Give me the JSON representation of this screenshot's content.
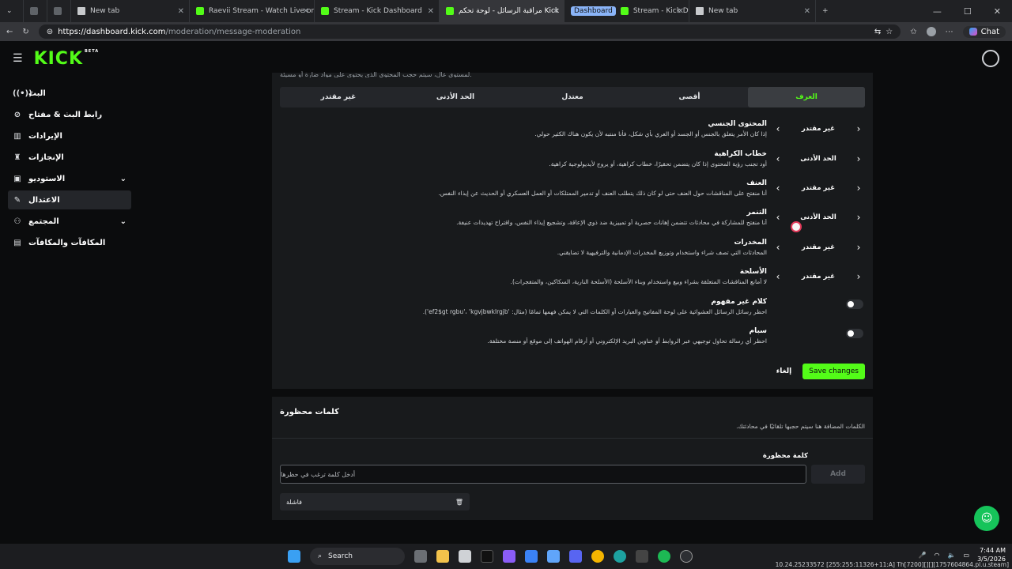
{
  "browser": {
    "tabs": [
      {
        "label": "",
        "favicon": "grey",
        "active": false
      },
      {
        "label": "",
        "favicon": "grey",
        "active": false
      },
      {
        "label": "New tab",
        "favicon": "doc",
        "active": false
      },
      {
        "label": "Raevii Stream - Watch Live on Kick",
        "favicon": "kick",
        "active": false
      },
      {
        "label": "Stream - Kick Dashboard",
        "favicon": "kick",
        "active": false
      },
      {
        "label": "مراقبة الرسائل - لوحة تحكم Kick",
        "favicon": "kick",
        "active": true
      },
      {
        "label": "Stream - Kick Dashboard",
        "favicon": "kick",
        "active": false,
        "group": "Dashboard"
      },
      {
        "label": "New tab",
        "favicon": "doc",
        "active": false
      }
    ],
    "url_host": "https://dashboard.kick.com",
    "url_path": "/moderation/message-moderation",
    "chat_label": "Chat"
  },
  "app": {
    "logo": "KICK",
    "logo_beta": "BETA",
    "sidebar": [
      {
        "label": "البث",
        "icon": "broadcast-icon",
        "active": false,
        "chevron": false
      },
      {
        "label": "رابط البث & مفتاح",
        "icon": "link-icon",
        "active": false,
        "chevron": false
      },
      {
        "label": "الإيرادات",
        "icon": "chart-icon",
        "active": false,
        "chevron": false
      },
      {
        "label": "الإنجازات",
        "icon": "trophy-icon",
        "active": false,
        "chevron": false
      },
      {
        "label": "الاستوديو",
        "icon": "studio-icon",
        "active": false,
        "chevron": true
      },
      {
        "label": "الاعتدال",
        "icon": "wrench-icon",
        "active": true,
        "chevron": false
      },
      {
        "label": "المجتمع",
        "icon": "community-icon",
        "active": false,
        "chevron": true
      },
      {
        "label": "المكافآت والمكافآت",
        "icon": "rewards-icon",
        "active": false,
        "chevron": false
      }
    ],
    "top_clip": "لمستوى عالٍ، سيتم حجب المحتوى الذي يحتوي على مواد ضارة أو مسيئة.",
    "levels": [
      "العرف",
      "أقصى",
      "معتدل",
      "الحد الأدنى",
      "غير مقتدر"
    ],
    "rules": [
      {
        "title": "المحتوى الجنسي",
        "desc": "إذا كان الأمر يتعلق بالجنس أو الجسد أو العري بأي شكل، فأنا منتبه لأن يكون هناك الكثير حولي.",
        "value": "غير مقتدر"
      },
      {
        "title": "خطاب الكراهية",
        "desc": "أود تجنب رؤية المحتوى إذا كان يتضمن تحقيرًا، خطاب كراهية، أو يروج لأيديولوجية كراهية.",
        "value": "الحد الأدنى"
      },
      {
        "title": "العنف",
        "desc": "أنا منفتح على المناقشات حول العنف حتى لو كان ذلك يتطلب العنف أو تدمير الممتلكات أو العمل العسكري أو الحديث عن إيذاء النفس.",
        "value": "غير مقتدر"
      },
      {
        "title": "التنمر",
        "desc": "أنا منفتح للمشاركة في محادثات تتضمن إهانات حصرية أو تمييزية ضد ذوي الإعاقة، وتشجيع إيذاء النفس، واقتراح تهديدات عنيفة.",
        "value": "الحد الأدنى"
      },
      {
        "title": "المخدرات",
        "desc": "المحادثات التي تصف شراء واستخدام وتوزيع المخدرات الإدمانية والترفيهية لا تضايقني.",
        "value": "غير مقتدر"
      },
      {
        "title": "الأسلحة",
        "desc": "لا أمانع المناقشات المتعلقة بشراء وبيع واستخدام وبناء الأسلحة (الأسلحة النارية، السكاكين، والمتفجرات).",
        "value": "غير مقتدر"
      }
    ],
    "toggles": [
      {
        "title": "كلام غير مفهوم",
        "desc": "احظر رسائل الرسائل العشوائية على لوحة المفاتيح والعبارات أو الكلمات التي لا يمكن فهمها تمامًا (مثال: 'ef2$gt rgbu'، 'kgvjbwklrgjb')."
      },
      {
        "title": "سبام",
        "desc": "احظر أي رسالة تحاول توجيهي عبر الروابط أو عناوين البريد الإلكتروني أو أرقام الهواتف إلى موقع أو منصة مختلفة."
      }
    ],
    "cancel_label": "إلغاء",
    "save_label": "Save changes",
    "banned": {
      "title": "كلمات محظورة",
      "desc": "الكلمات المضافة هنا سيتم حجبها تلقائيًا في محادثتك.",
      "label": "كلمة محظورة",
      "placeholder": "أدخل كلمة ترغب في حظرها",
      "add_label": "Add",
      "words": [
        "فاشلة"
      ]
    }
  },
  "taskbar": {
    "search_label": "Search",
    "time": "7:44 AM",
    "date": "3/5/2026",
    "overlay": "10.24.25233572 [255:255:11326+11:A] Th[7200][][][1757604864.pl.u.steam]"
  },
  "colors": {
    "accent": "#53fc18",
    "panel": "#181a1c",
    "background": "#0b0c0d"
  }
}
